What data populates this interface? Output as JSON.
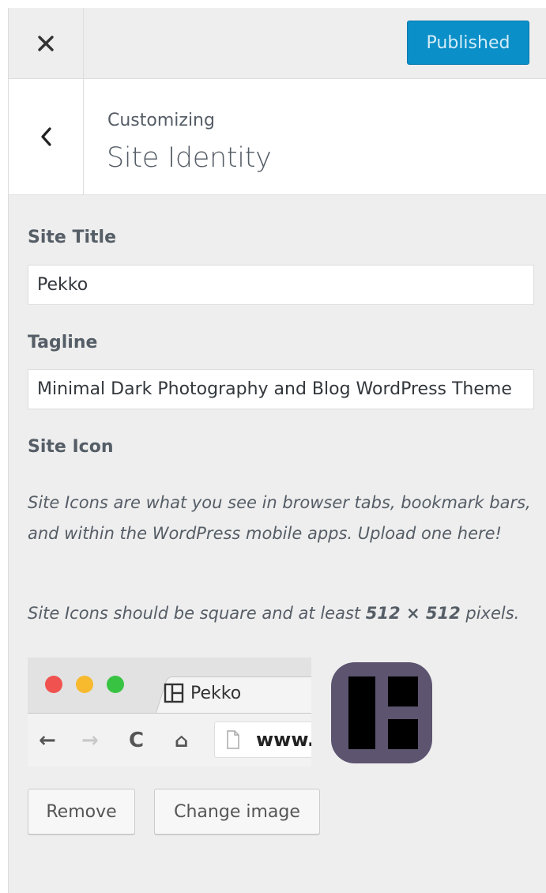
{
  "header": {
    "close_icon": "close-icon",
    "publish_label": "Published",
    "publish_color": "#0a8fc8"
  },
  "section": {
    "back_icon": "chevron-left-icon",
    "breadcrumb": "Customizing",
    "title": "Site Identity"
  },
  "site_title": {
    "label": "Site Title",
    "value": "Pekko"
  },
  "tagline": {
    "label": "Tagline",
    "value": "Minimal Dark Photography and Blog WordPress Theme"
  },
  "site_icon": {
    "label": "Site Icon",
    "description": "Site Icons are what you see in browser tabs, bookmark bars, and within the WordPress mobile apps. Upload one here!",
    "size_note_prefix": "Site Icons should be square and at least ",
    "size_note_bold": "512 × 512",
    "size_note_suffix": " pixels.",
    "preview": {
      "tab_label": "Pekko",
      "url_text": "www."
    },
    "icon_color": "#5d5470"
  },
  "actions": {
    "remove_label": "Remove",
    "change_label": "Change image"
  }
}
